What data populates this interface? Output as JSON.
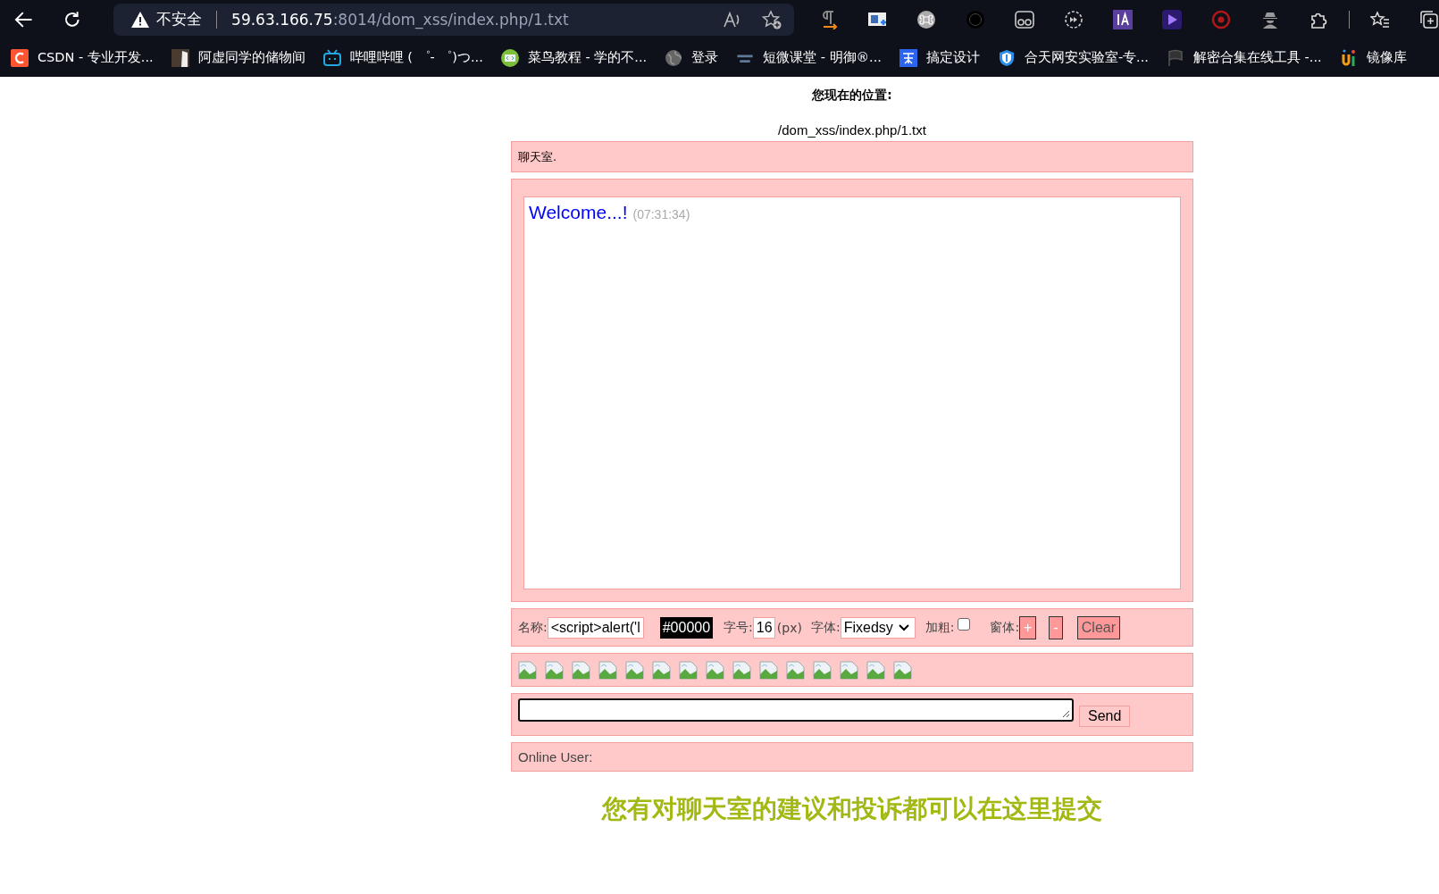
{
  "browser": {
    "address": {
      "warning": "不安全",
      "host": "59.63.166.75",
      "rest": ":8014/dom_xss/index.php/1.txt"
    },
    "bookmarks": [
      {
        "label": "CSDN - 专业开发..."
      },
      {
        "label": "阿虚同学的储物间"
      },
      {
        "label": "哔哩哔哩 ( ゜- ゜)つ..."
      },
      {
        "label": "菜鸟教程 - 学的不..."
      },
      {
        "label": "登录"
      },
      {
        "label": "短微课堂 - 明御®..."
      },
      {
        "label": "搞定设计"
      },
      {
        "label": "合天网安实验室-专..."
      },
      {
        "label": "解密合集在线工具 -..."
      },
      {
        "label": "镜像库"
      }
    ]
  },
  "page": {
    "location_label": "您现在的位置:",
    "path": "/dom_xss/index.php/1.txt",
    "room_title": "聊天室.",
    "messages": [
      {
        "text": "Welcome...!",
        "time": "(07:31:34)"
      }
    ],
    "controls": {
      "name_label": "名称:",
      "name_value": "<script>alert('l",
      "color_value": "#00000",
      "size_label": "字号:",
      "size_value": "16",
      "size_unit": "(px)",
      "font_label": "字体:",
      "font_value": "Fixedsy",
      "bold_label": "加粗:",
      "bold_checked": false,
      "window_label": "窗体:",
      "plus": "+",
      "minus": "-",
      "clear": "Clear"
    },
    "send": "Send",
    "online_label": "Online User:",
    "footer": "您有对聊天室的建议和投诉都可以在这里提交"
  }
}
